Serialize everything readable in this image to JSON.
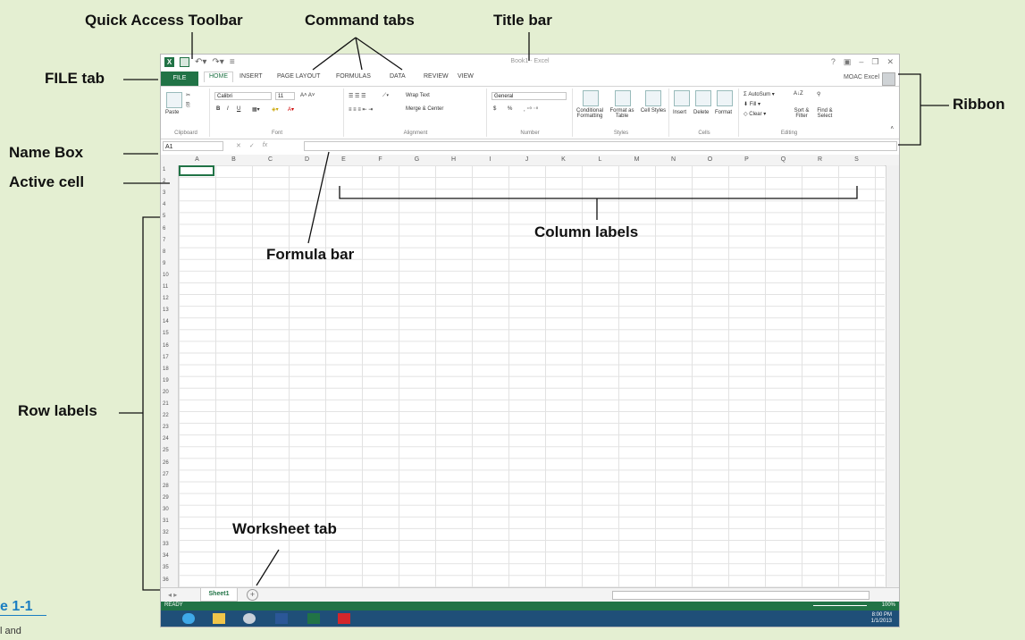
{
  "callouts": {
    "quick_access_toolbar": "Quick Access Toolbar",
    "command_tabs": "Command tabs",
    "title_bar": "Title bar",
    "file_tab": "FILE tab",
    "ribbon": "Ribbon",
    "name_box": "Name Box",
    "active_cell": "Active cell",
    "formula_bar": "Formula bar",
    "column_labels": "Column labels",
    "row_labels": "Row labels",
    "worksheet_tab": "Worksheet tab"
  },
  "figure": {
    "label": "e 1-1",
    "note": "l and"
  },
  "excel": {
    "title": "Book1 - Excel",
    "account": "MOAC Excel",
    "tabs": [
      "FILE",
      "HOME",
      "INSERT",
      "PAGE LAYOUT",
      "FORMULAS",
      "DATA",
      "REVIEW",
      "VIEW"
    ],
    "ribbon": {
      "clipboard": {
        "label": "Clipboard",
        "paste": "Paste"
      },
      "font": {
        "label": "Font",
        "name": "Calibri",
        "size": "11",
        "bold": "B",
        "italic": "I",
        "underline": "U"
      },
      "alignment": {
        "label": "Alignment",
        "wrap": "Wrap Text",
        "merge": "Merge & Center"
      },
      "number": {
        "label": "Number",
        "format": "General",
        "currency": "$",
        "percent": "%"
      },
      "styles": {
        "label": "Styles",
        "conditional": "Conditional Formatting",
        "format_table": "Format as Table",
        "cell_styles": "Cell Styles"
      },
      "cells": {
        "label": "Cells",
        "insert": "Insert",
        "delete": "Delete",
        "format": "Format"
      },
      "editing": {
        "label": "Editing",
        "autosum": "AutoSum",
        "fill": "Fill",
        "clear": "Clear",
        "sort": "Sort & Filter",
        "find": "Find & Select"
      }
    },
    "name_box": "A1",
    "fx": "fx",
    "columns": [
      "A",
      "B",
      "C",
      "D",
      "E",
      "F",
      "G",
      "H",
      "I",
      "J",
      "K",
      "L",
      "M",
      "N",
      "O",
      "P",
      "Q",
      "R",
      "S"
    ],
    "sheet_tab": "Sheet1",
    "status": "READY",
    "zoom": "100%",
    "clock_time": "8:00 PM",
    "clock_date": "1/1/2013"
  }
}
